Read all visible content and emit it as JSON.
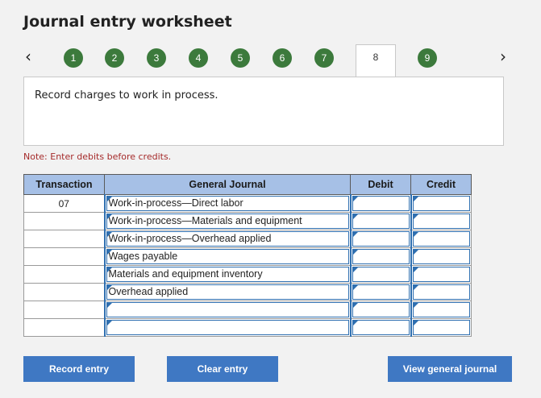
{
  "title": "Journal entry worksheet",
  "nav": {
    "prev_glyph": "‹",
    "next_glyph": "›",
    "steps": [
      "1",
      "2",
      "3",
      "4",
      "5",
      "6",
      "7",
      "8",
      "9"
    ],
    "active_step": "8"
  },
  "instruction": "Record charges to work in process.",
  "note": "Note: Enter debits before credits.",
  "table": {
    "headers": {
      "transaction": "Transaction",
      "general_journal": "General Journal",
      "debit": "Debit",
      "credit": "Credit"
    },
    "rows": [
      {
        "transaction": "07",
        "account": "Work-in-process—Direct labor",
        "debit": "",
        "credit": ""
      },
      {
        "transaction": "",
        "account": "Work-in-process—Materials and equipment",
        "debit": "",
        "credit": ""
      },
      {
        "transaction": "",
        "account": "Work-in-process—Overhead applied",
        "debit": "",
        "credit": ""
      },
      {
        "transaction": "",
        "account": "Wages payable",
        "debit": "",
        "credit": ""
      },
      {
        "transaction": "",
        "account": "Materials and equipment inventory",
        "debit": "",
        "credit": ""
      },
      {
        "transaction": "",
        "account": "Overhead applied",
        "debit": "",
        "credit": ""
      },
      {
        "transaction": "",
        "account": "",
        "debit": "",
        "credit": ""
      },
      {
        "transaction": "",
        "account": "",
        "debit": "",
        "credit": ""
      }
    ]
  },
  "buttons": {
    "record": "Record entry",
    "clear": "Clear entry",
    "view": "View general journal"
  },
  "colors": {
    "step_green": "#3c7a3c",
    "header_blue": "#a6c0e6",
    "button_blue": "#3f78c3",
    "note_red": "#a52a2a"
  }
}
